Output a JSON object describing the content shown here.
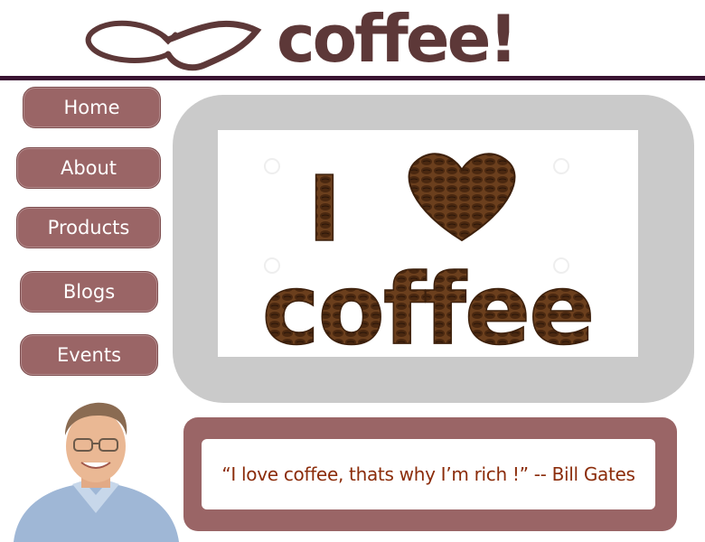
{
  "header": {
    "logo_text": "coffee!"
  },
  "nav": {
    "items": [
      {
        "label": "Home"
      },
      {
        "label": "About"
      },
      {
        "label": "Products"
      },
      {
        "label": "Blogs"
      },
      {
        "label": "Events"
      }
    ]
  },
  "hero": {
    "line1_letter": "I",
    "line2_word": "coffee"
  },
  "quote": {
    "text": "“I love coffee, thats why I’m rich !” -- Bill Gates"
  },
  "colors": {
    "brand_brown": "#5d3838",
    "nav_button": "#9a6566",
    "header_rule": "#3a1232",
    "hero_frame": "#cacaca",
    "quote_text": "#8b2c0a",
    "bean_brown": "#5a3418"
  },
  "icons": {
    "logo_heart": "heart-outline-icon"
  }
}
